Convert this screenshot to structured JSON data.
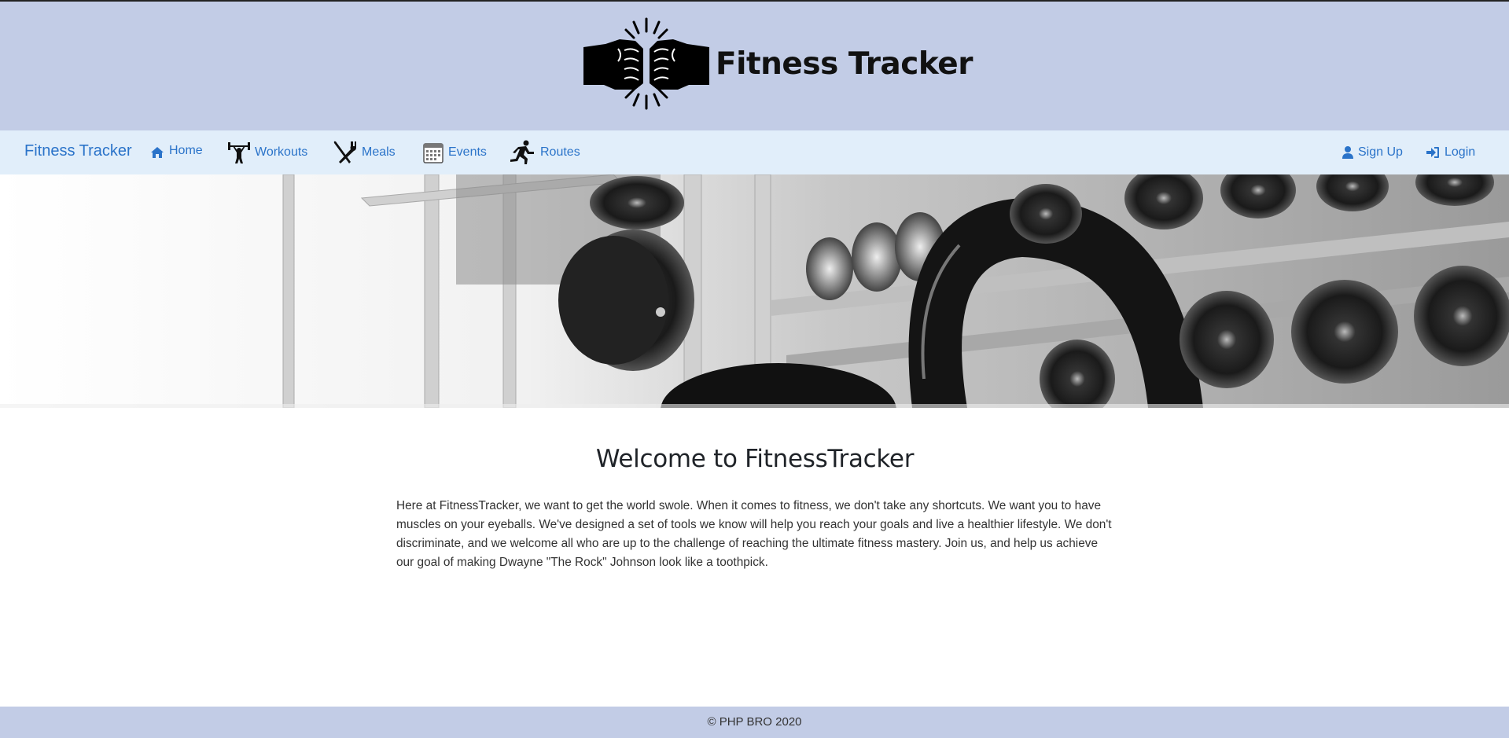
{
  "header": {
    "logo_icon": "fist-bump-icon",
    "title": "Fitness Tracker"
  },
  "navbar": {
    "brand": "Fitness Tracker",
    "items": [
      {
        "label": "Home",
        "icon": "home-icon"
      },
      {
        "label": "Workouts",
        "icon": "weightlifter-icon"
      },
      {
        "label": "Meals",
        "icon": "utensils-icon"
      },
      {
        "label": "Events",
        "icon": "calendar-icon"
      },
      {
        "label": "Routes",
        "icon": "runner-icon"
      }
    ],
    "right_items": [
      {
        "label": "Sign Up",
        "icon": "user-icon"
      },
      {
        "label": "Login",
        "icon": "sign-in-icon"
      }
    ]
  },
  "hero": {
    "image": "gym-dumbbells-banner"
  },
  "main": {
    "heading": "Welcome to FitnessTracker",
    "intro": "Here at FitnessTracker, we want to get the world swole. When it comes to fitness, we don't take any shortcuts. We want you to have muscles on your eyeballs. We've designed a set of tools we know will help you reach your goals and live a healthier lifestyle. We don't discriminate, and we welcome all who are up to the challenge of reaching the ultimate fitness mastery. Join us, and help us achieve our goal of making Dwayne \"The Rock\" Johnson look like a toothpick."
  },
  "footer": {
    "copyright": "© PHP BRO 2020"
  },
  "colors": {
    "header_bg": "#c2cce6",
    "navbar_bg": "#e1eefa",
    "link": "#2a73c9",
    "footer_bg": "#c2cce6"
  }
}
